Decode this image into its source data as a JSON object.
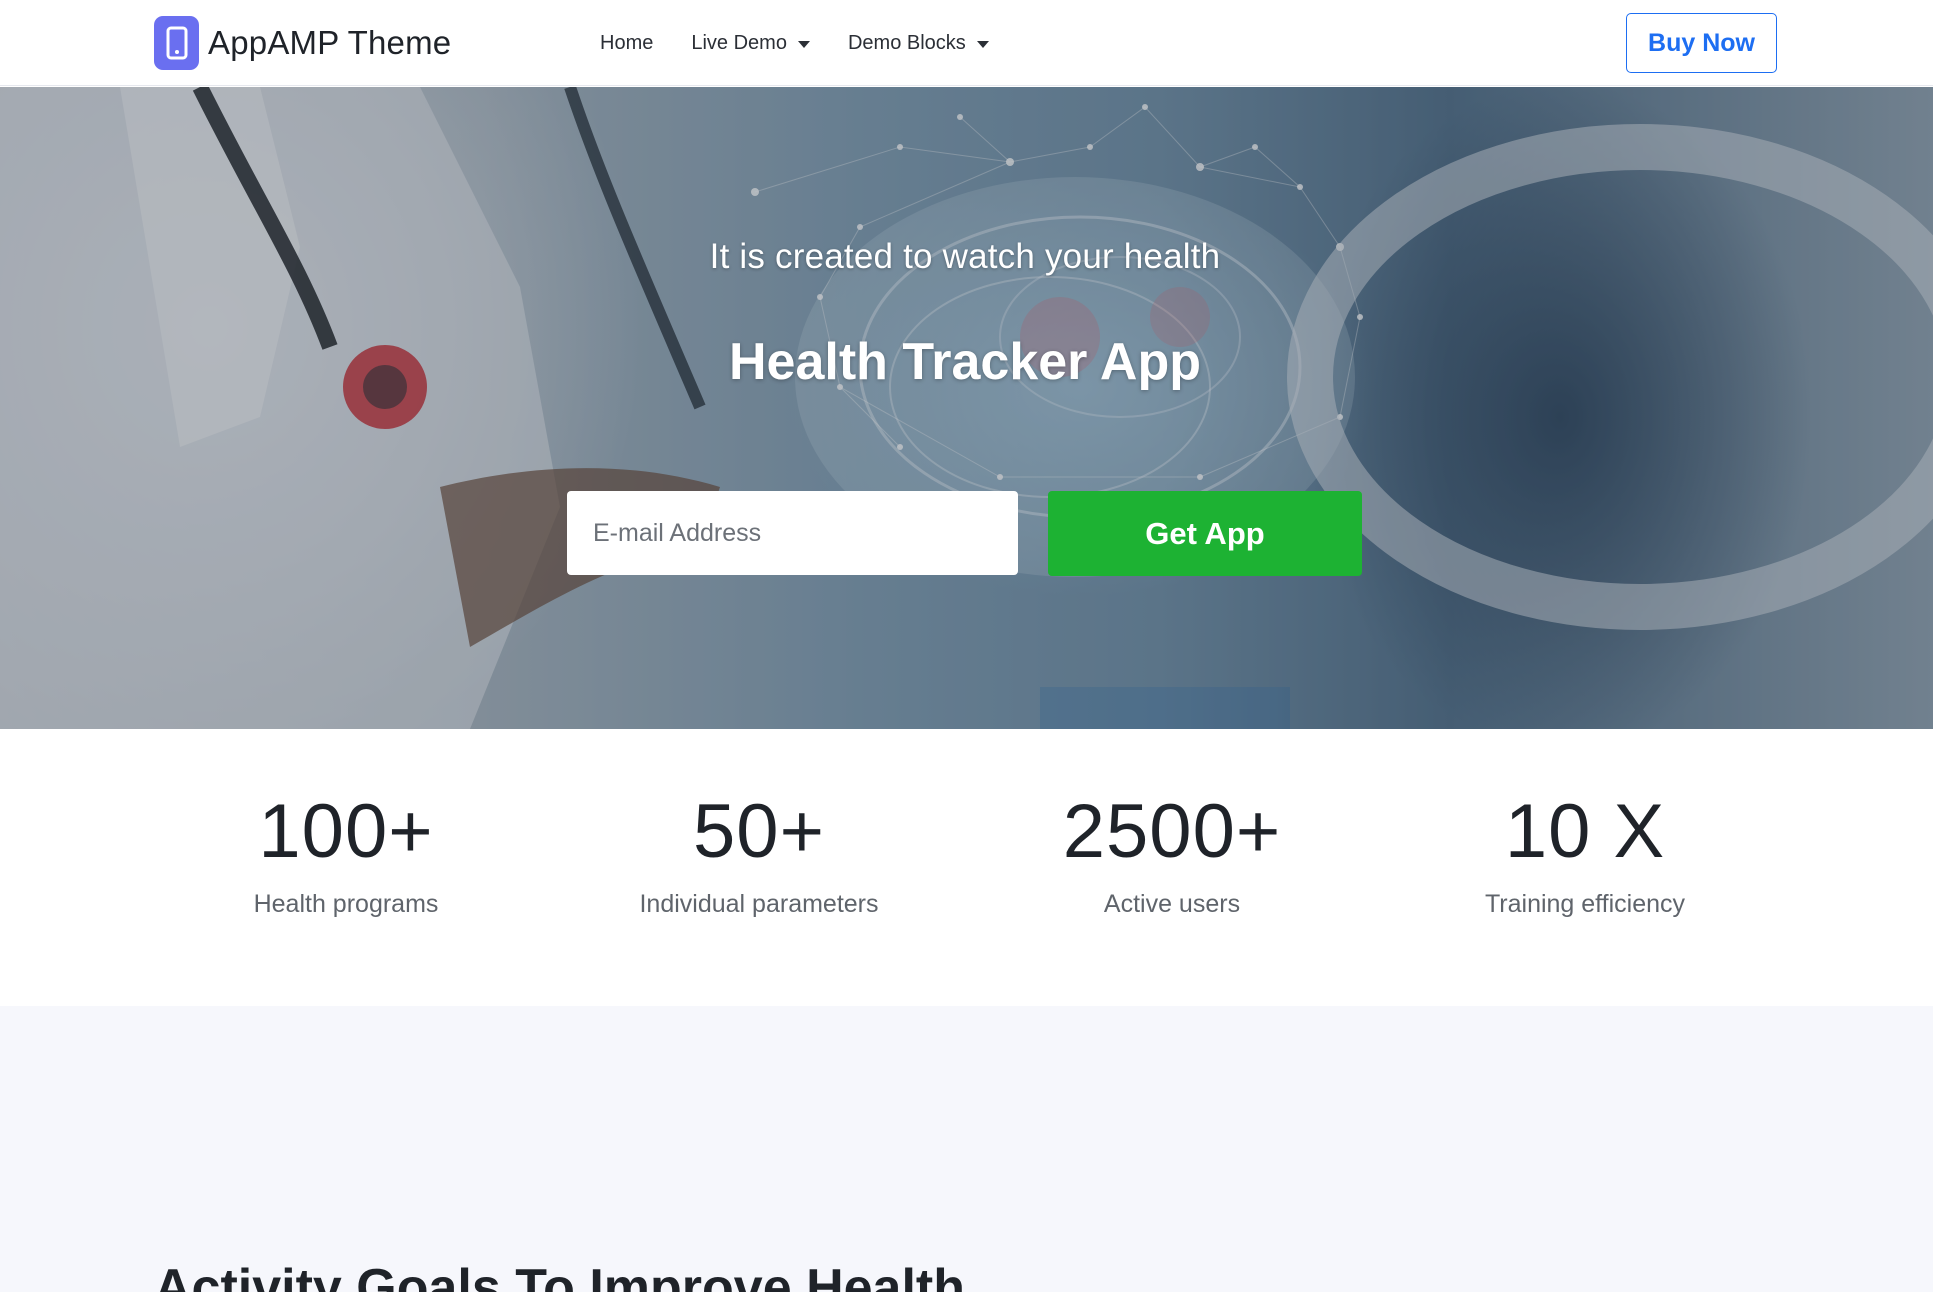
{
  "navbar": {
    "brand_name": "AppAMP Theme",
    "brand_icon": "smartphone-icon",
    "links": [
      {
        "label": "Home",
        "dropdown": false
      },
      {
        "label": "Live Demo",
        "dropdown": true
      },
      {
        "label": "Demo Blocks",
        "dropdown": true
      }
    ],
    "cta_label": "Buy Now"
  },
  "hero": {
    "subtitle": "It is created to watch your health",
    "title": "Health Tracker App",
    "email_placeholder": "E-mail Address",
    "button_label": "Get App"
  },
  "stats": [
    {
      "value": "100+",
      "label": "Health programs"
    },
    {
      "value": "50+",
      "label": "Individual parameters"
    },
    {
      "value": "2500+",
      "label": "Active users"
    },
    {
      "value": "10 X",
      "label": "Training efficiency"
    }
  ],
  "features": {
    "title": "Activity Goals To Improve Health"
  },
  "colors": {
    "brand_icon": "#6a6ff0",
    "primary_blue": "#1d6ef2",
    "cta_green": "#1db233",
    "text_dark": "#1f2329",
    "text_muted": "#5f646b",
    "section_bg": "#f6f7fc"
  }
}
